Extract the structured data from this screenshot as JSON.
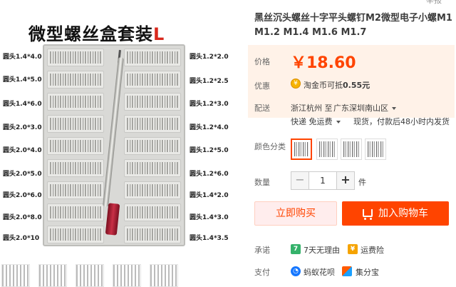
{
  "header": {
    "top_cut_text": "举报"
  },
  "image": {
    "title": "微型螺丝盒套装",
    "title_accent": "L",
    "left_labels": [
      "圆头1.4*4.0",
      "圆头1.4*5.0",
      "圆头1.4*6.0",
      "圆头2.0*3.0",
      "圆头2.0*4.0",
      "圆头2.0*5.0",
      "圆头2.0*6.0",
      "圆头2.0*8.0",
      "圆头2.0*10"
    ],
    "right_labels": [
      "圆头1.2*2.0",
      "圆头1.2*2.5",
      "圆头1.2*3.0",
      "圆头1.2*4.0",
      "圆头1.2*5.0",
      "圆头1.2*6.0",
      "圆头1.4*2.0",
      "圆头1.4*3.0",
      "圆头1.4*3.5"
    ]
  },
  "product": {
    "title": "黑丝沉头螺丝十字平头螺钉M2微型电子小螺M1 M1.2 M1.4 M1.6 M1.7"
  },
  "price": {
    "label": "价格",
    "value": "￥18.60"
  },
  "discount": {
    "label": "优惠",
    "text": "淘金币可抵",
    "amount": "0.55元"
  },
  "shipping": {
    "label": "配送",
    "from": "浙江杭州",
    "to_word": "至",
    "destination": "广东深圳南山区",
    "method": "快递 免运费",
    "stock": "现货，付款后48小时内发货"
  },
  "color": {
    "label": "颜色分类"
  },
  "quantity": {
    "label": "数量",
    "value": "1",
    "unit": "件",
    "minus": "−",
    "plus": "+"
  },
  "actions": {
    "buy_now": "立即购买",
    "add_cart": "加入购物车"
  },
  "promise": {
    "label": "承诺",
    "items": [
      "7天无理由",
      "运费险"
    ],
    "icon1": "7"
  },
  "payment": {
    "label": "支付",
    "items": [
      "蚂蚁花呗",
      "集分宝"
    ]
  }
}
